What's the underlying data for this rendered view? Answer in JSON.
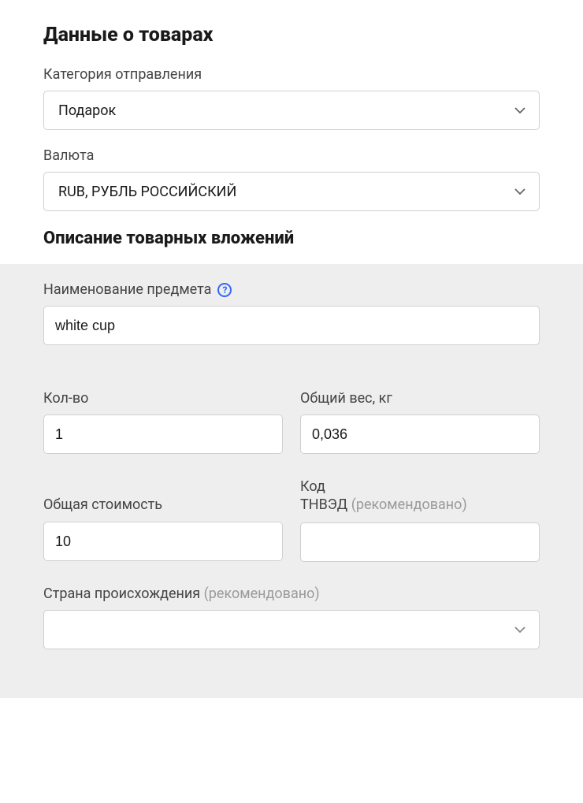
{
  "section1": {
    "heading": "Данные о товарах",
    "category": {
      "label": "Категория отправления",
      "value": "Подарок"
    },
    "currency": {
      "label": "Валюта",
      "value": "RUB, РУБЛЬ РОССИЙСКИЙ"
    },
    "subheading": "Описание товарных вложений"
  },
  "section2": {
    "item_name": {
      "label": "Наименование предмета",
      "value": "white cup"
    },
    "quantity": {
      "label": "Кол-во",
      "value": "1"
    },
    "total_weight": {
      "label": "Общий вес, кг",
      "value": "0,036"
    },
    "total_cost": {
      "label": "Общая стоимость",
      "value": "10"
    },
    "tnved": {
      "label_line1": "Код",
      "label_line2": "ТНВЭД",
      "hint": "(рекомендовано)",
      "value": ""
    },
    "origin_country": {
      "label": "Страна происхождения",
      "hint": "(рекомендовано)",
      "value": ""
    }
  }
}
